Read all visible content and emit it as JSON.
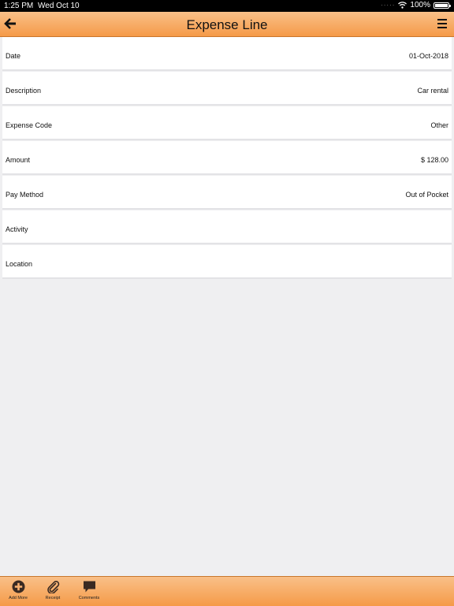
{
  "status_bar": {
    "time": "1:25 PM",
    "date": "Wed Oct 10",
    "battery": "100%"
  },
  "header": {
    "title": "Expense Line",
    "back_icon": "arrow-left-icon",
    "menu_icon": "hamburger-menu-icon"
  },
  "fields": [
    {
      "label": "Date",
      "value": "01-Oct-2018"
    },
    {
      "label": "Description",
      "value": "Car rental"
    },
    {
      "label": "Expense Code",
      "value": "Other"
    },
    {
      "label": "Amount",
      "value": "$ 128.00"
    },
    {
      "label": "Pay Method",
      "value": "Out of Pocket"
    },
    {
      "label": "Activity",
      "value": ""
    },
    {
      "label": "Location",
      "value": ""
    }
  ],
  "toolbar": {
    "items": [
      {
        "label": "Add More",
        "icon": "plus-circle-icon"
      },
      {
        "label": "Receipt",
        "icon": "paperclip-icon"
      },
      {
        "label": "Comments",
        "icon": "speech-bubble-icon"
      }
    ]
  },
  "colors": {
    "header_gradient_top": "#f9c088",
    "header_gradient_bottom": "#f59a48",
    "background": "#efeff1"
  }
}
